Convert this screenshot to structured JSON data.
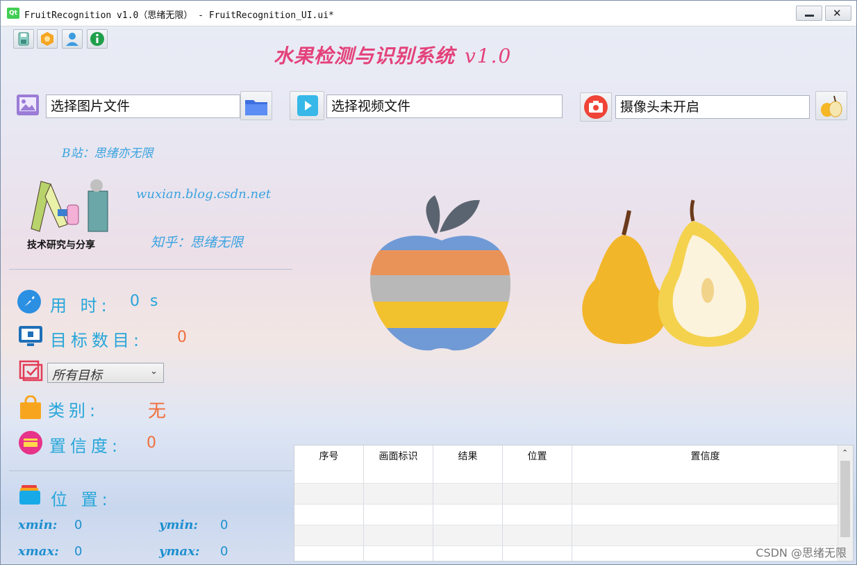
{
  "window": {
    "title": "FruitRecognition v1.0（思绪无限） - FruitRecognition_UI.ui*",
    "qt_badge": "Qt"
  },
  "toolbar": {
    "icons": [
      "save-icon",
      "hexagon-icon",
      "user-icon",
      "info-icon"
    ]
  },
  "header": {
    "title": "水果检测与识别系统",
    "version": "v1.0"
  },
  "inputs": {
    "image_file": "选择图片文件",
    "video_file": "选择视频文件",
    "camera": "摄像头未开启"
  },
  "sidebar": {
    "bilibili": "B站：思绪亦无限",
    "blog": "wuxian.blog.csdn.net",
    "zhihu": "知乎：思绪无限",
    "logo_caption": "技术研究与分享"
  },
  "stats": {
    "time_label": "用 时:",
    "time_value": "0 s",
    "count_label": "目标数目:",
    "count_value": "0",
    "target_select": "所有目标",
    "class_label": "类别:",
    "class_value": "无",
    "confidence_label": "置信度:",
    "confidence_value": "0",
    "position_label": "位 置:"
  },
  "coords": {
    "xmin_label": "xmin:",
    "xmin": "0",
    "ymin_label": "ymin:",
    "ymin": "0",
    "xmax_label": "xmax:",
    "xmax": "0",
    "ymax_label": "ymax:",
    "ymax": "0"
  },
  "table": {
    "columns": [
      "序号",
      "画面标识",
      "结果",
      "位置",
      "置信度"
    ],
    "rows": 4
  },
  "watermark": "CSDN @思绪无限",
  "colors": {
    "title": "#e4417a",
    "accent_blue": "#27a6d9",
    "value_orange": "#f06e3c"
  }
}
